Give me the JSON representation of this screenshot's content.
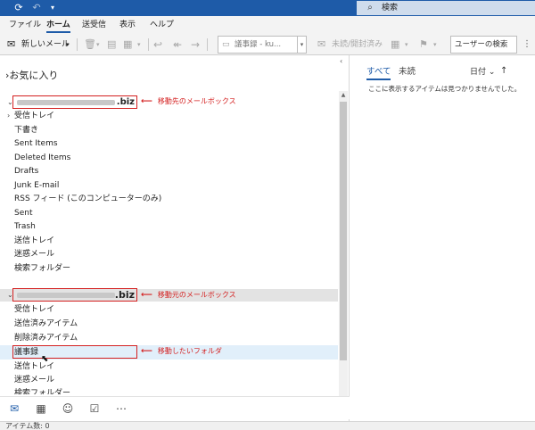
{
  "titlebar": {
    "search_placeholder": "検索"
  },
  "menu": {
    "tabs": [
      "ファイル",
      "ホーム",
      "送受信",
      "表示",
      "ヘルプ"
    ],
    "active_tab": "ホーム"
  },
  "toolbar": {
    "new_mail_label": "新しいメール",
    "move_combo_text": "議事録 - ku...",
    "read_unread_label": "未読/開封済み",
    "user_search_placeholder": "ユーザーの検索"
  },
  "left_pane": {
    "favorites_label": "お気に入り",
    "account1": {
      "suffix": ".biz",
      "annotation": "移動先のメールボックス",
      "folders": [
        "受信トレイ",
        "下書き",
        "Sent Items",
        "Deleted Items",
        "Drafts",
        "Junk E-mail",
        "RSS フィード (このコンピューターのみ)",
        "Sent",
        "Trash",
        "送信トレイ",
        "迷惑メール",
        "検索フォルダー"
      ]
    },
    "account2": {
      "suffix": ".biz",
      "annotation": "移動元のメールボックス",
      "folders": [
        "受信トレイ",
        "送信済みアイテム",
        "削除済みアイテム",
        "議事録",
        "送信トレイ",
        "迷惑メール",
        "検索フォルダー"
      ],
      "selected_annotation": "移動したいフォルダ"
    }
  },
  "right_pane": {
    "tab_all": "すべて",
    "tab_unread": "未読",
    "sort_label": "日付",
    "empty_message": "ここに表示するアイテムは見つかりませんでした。"
  },
  "status": {
    "item_count": "アイテム数: 0"
  },
  "colors": {
    "titlebar": "#1e5ba8",
    "accent": "#1e5ba8",
    "annotation_red": "#d42020"
  }
}
